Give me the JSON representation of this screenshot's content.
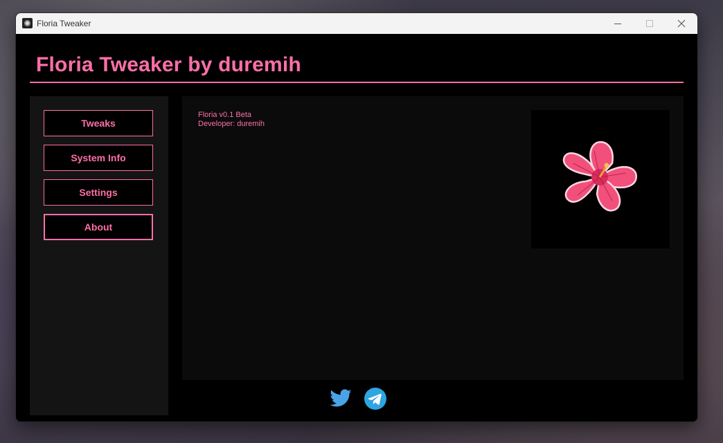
{
  "window": {
    "title": "Floria Tweaker"
  },
  "header": {
    "title": "Floria Tweaker by duremih"
  },
  "sidebar": {
    "items": [
      {
        "label": "Tweaks"
      },
      {
        "label": "System Info"
      },
      {
        "label": "Settings"
      },
      {
        "label": "About",
        "active": true
      }
    ]
  },
  "main": {
    "version": "Floria v0.1 Beta",
    "developer": "Developer: duremih",
    "image": "hibiscus-flower"
  },
  "footer": {
    "icons": [
      "twitter-icon",
      "telegram-icon"
    ]
  },
  "colors": {
    "accent": "#ff6fa8",
    "background": "#000000",
    "sidebar": "#141414",
    "panel": "#0b0b0b",
    "twitter": "#4aa3e6",
    "telegram": "#2ea4e0"
  }
}
